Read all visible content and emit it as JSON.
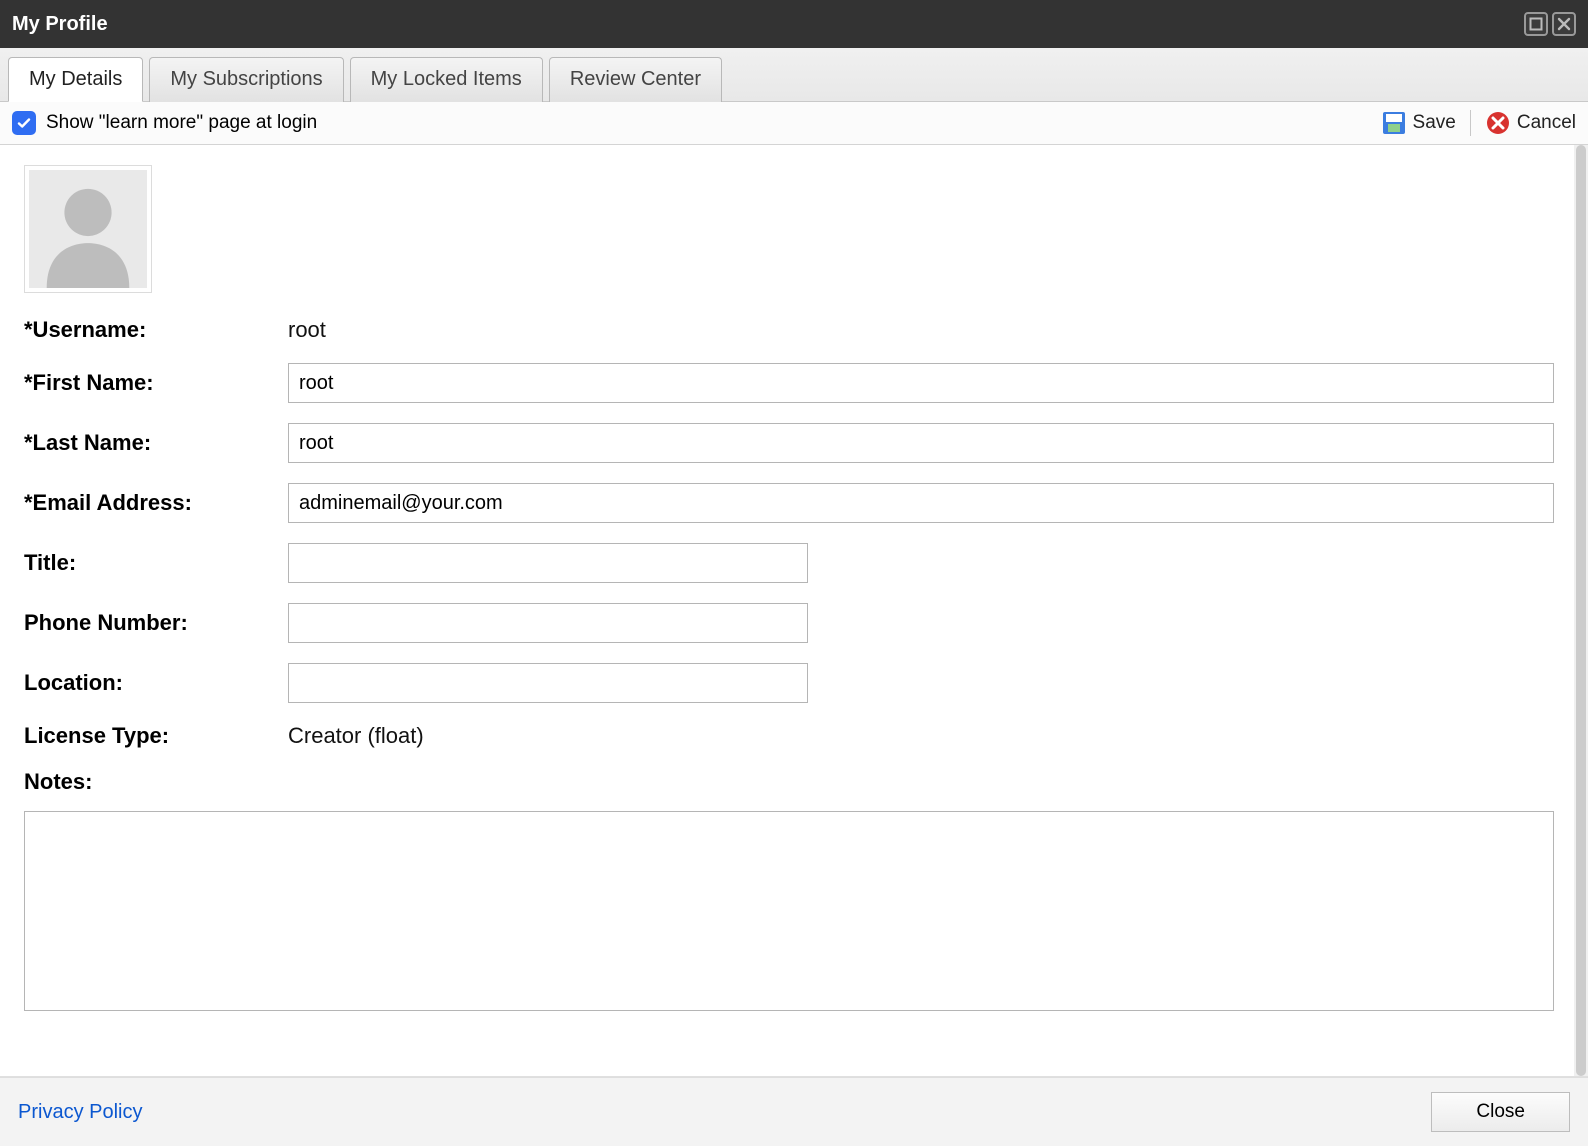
{
  "window": {
    "title": "My Profile"
  },
  "tabs": [
    {
      "label": "My Details",
      "active": true
    },
    {
      "label": "My Subscriptions",
      "active": false
    },
    {
      "label": "My Locked Items",
      "active": false
    },
    {
      "label": "Review Center",
      "active": false
    }
  ],
  "toolbar": {
    "learn_more_checked": true,
    "learn_more_label": "Show \"learn more\" page at login",
    "save_label": "Save",
    "cancel_label": "Cancel"
  },
  "form": {
    "username_label": "*Username:",
    "username_value": "root",
    "first_name_label": "*First Name:",
    "first_name_value": "root",
    "last_name_label": "*Last Name:",
    "last_name_value": "root",
    "email_label": "*Email Address:",
    "email_value": "adminemail@your.com",
    "title_label": "Title:",
    "title_value": "",
    "phone_label": "Phone Number:",
    "phone_value": "",
    "location_label": "Location:",
    "location_value": "",
    "license_label": "License Type:",
    "license_value": "Creator (float)",
    "notes_label": "Notes:",
    "notes_value": ""
  },
  "footer": {
    "privacy_label": "Privacy Policy",
    "close_label": "Close"
  }
}
